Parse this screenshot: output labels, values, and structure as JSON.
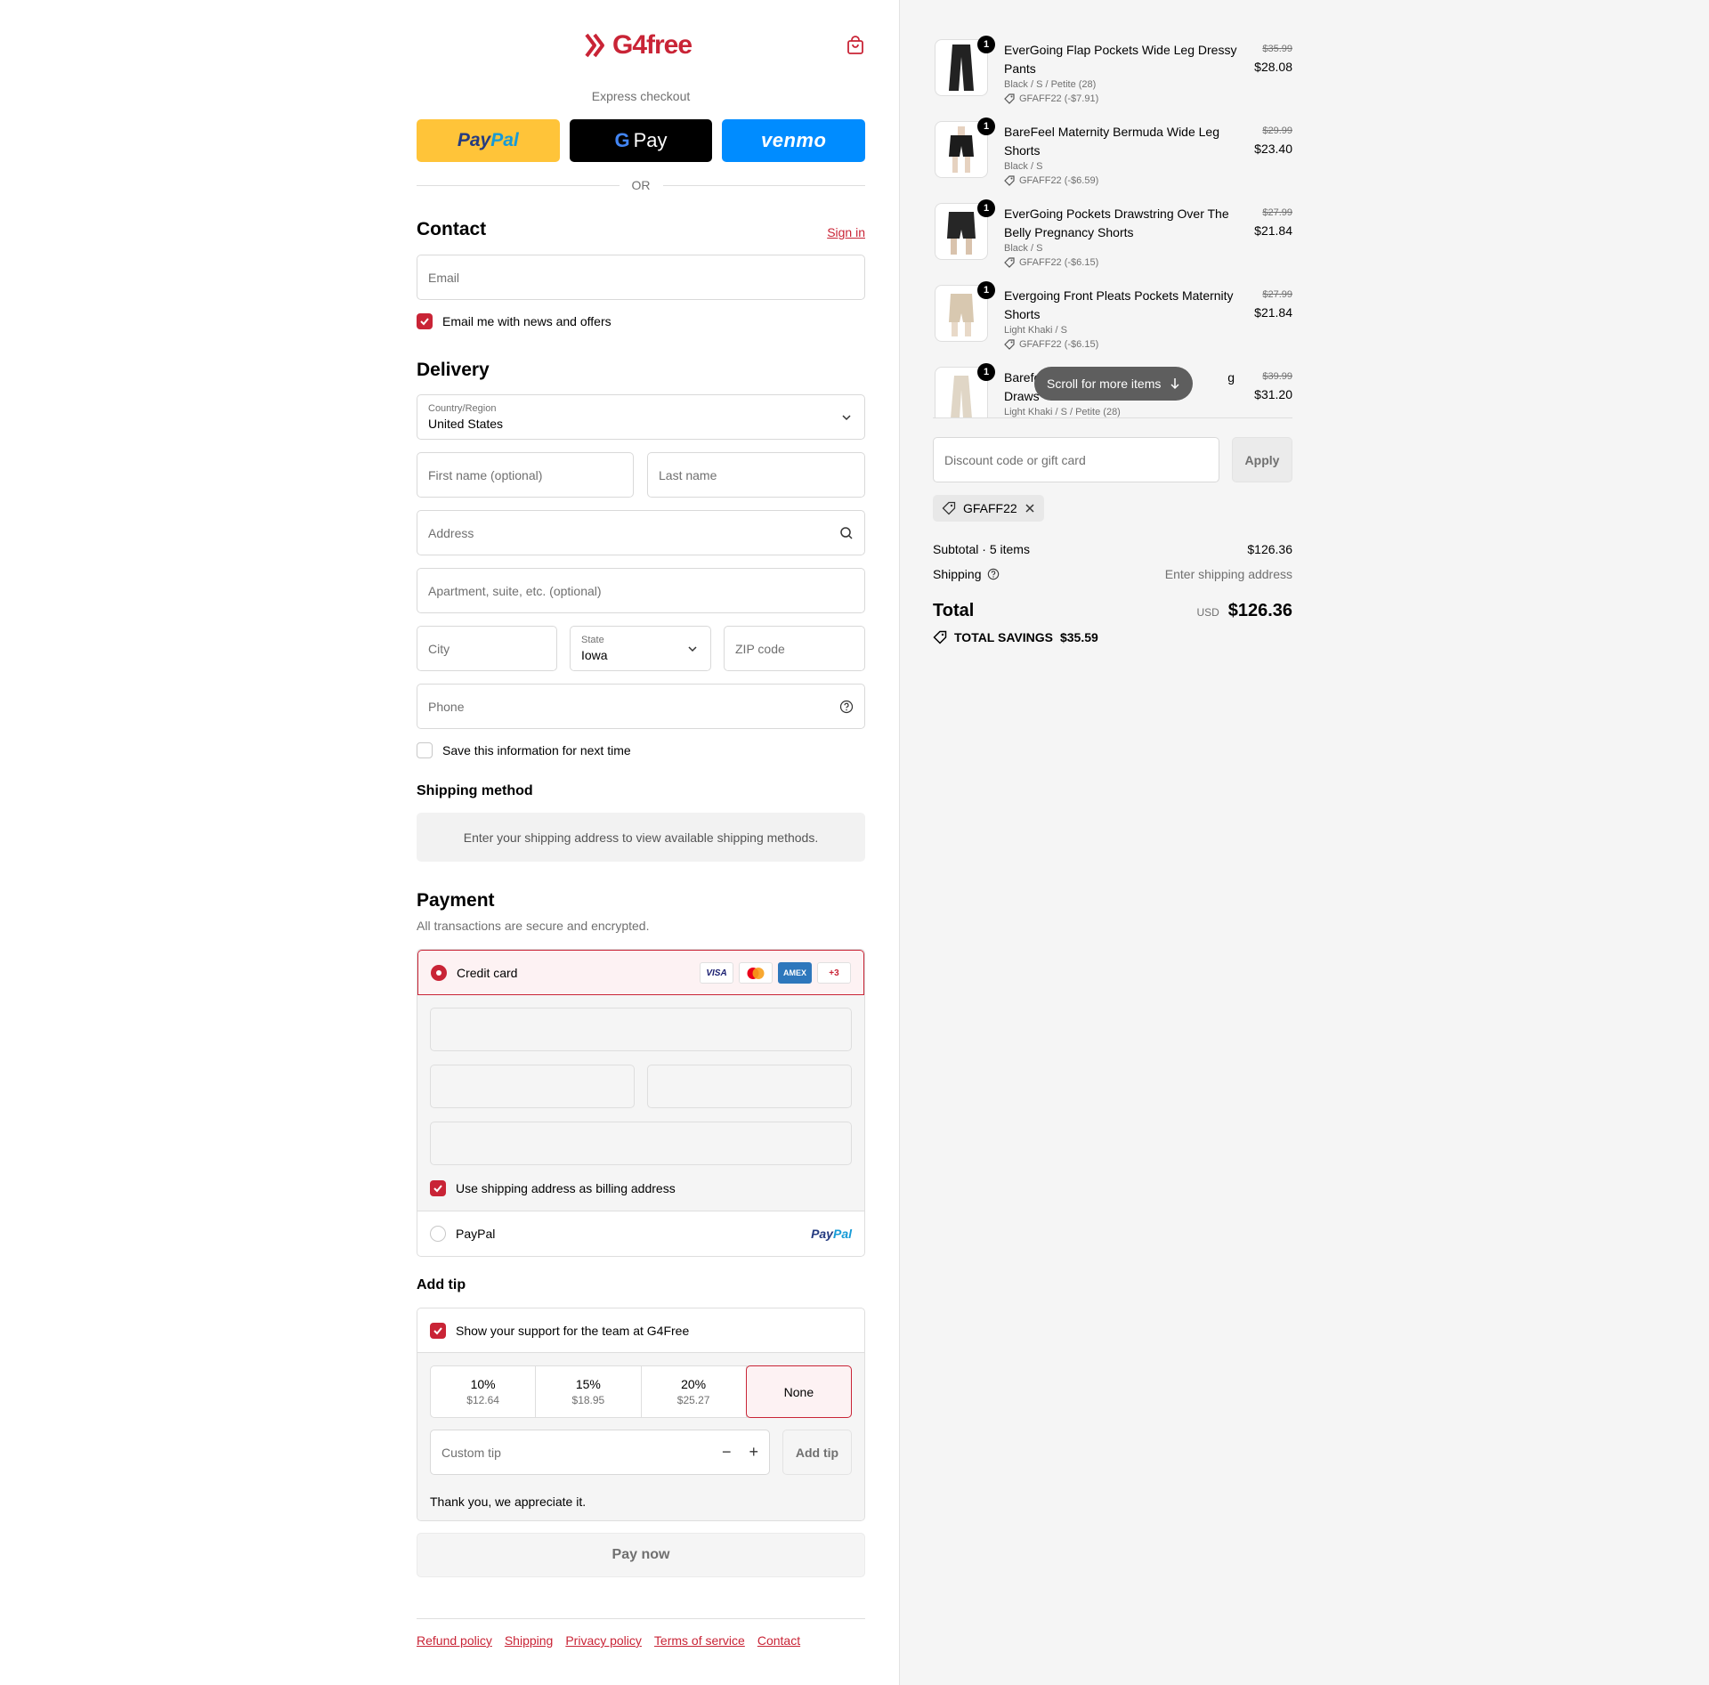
{
  "brand": {
    "name": "G4free",
    "accent": "#c92436"
  },
  "header": {
    "cart_icon": "shopping-bag-icon"
  },
  "express": {
    "label": "Express checkout",
    "paypal_a": "Pay",
    "paypal_b": "Pal",
    "gpay_g": "G",
    "gpay_label": "Pay",
    "venmo_label": "venmo",
    "or_label": "OR"
  },
  "contact": {
    "title": "Contact",
    "sign_in": "Sign in",
    "email_placeholder": "Email",
    "news_label": "Email me with news and offers",
    "news_checked": true
  },
  "delivery": {
    "title": "Delivery",
    "country_label": "Country/Region",
    "country_value": "United States",
    "first_name_placeholder": "First name (optional)",
    "last_name_placeholder": "Last name",
    "address_placeholder": "Address",
    "apartment_placeholder": "Apartment, suite, etc. (optional)",
    "city_placeholder": "City",
    "state_label": "State",
    "state_value": "Iowa",
    "zip_placeholder": "ZIP code",
    "phone_placeholder": "Phone",
    "save_label": "Save this information for next time",
    "save_checked": false
  },
  "shipping_method": {
    "title": "Shipping method",
    "message": "Enter your shipping address to view available shipping methods."
  },
  "payment": {
    "title": "Payment",
    "subtitle": "All transactions are secure and encrypted.",
    "credit_card_label": "Credit card",
    "card_logos": [
      "VISA",
      "mastercard",
      "AMEX",
      "+3"
    ],
    "billing_label": "Use shipping address as billing address",
    "billing_checked": true,
    "paypal_label": "PayPal",
    "paypal_logo_a": "Pay",
    "paypal_logo_b": "Pal"
  },
  "tip": {
    "title": "Add tip",
    "support_label": "Show your support for the team at G4Free",
    "support_checked": true,
    "options": [
      {
        "pct": "10%",
        "amount": "$12.64"
      },
      {
        "pct": "15%",
        "amount": "$18.95"
      },
      {
        "pct": "20%",
        "amount": "$25.27"
      },
      {
        "pct": "None",
        "amount": ""
      }
    ],
    "selected": "None",
    "custom_placeholder": "Custom tip",
    "minus": "−",
    "plus": "+",
    "add_button": "Add tip",
    "thanks": "Thank you, we appreciate it."
  },
  "pay_now": "Pay now",
  "footer": {
    "links": [
      "Refund policy",
      "Shipping",
      "Privacy policy",
      "Terms of service",
      "Contact"
    ]
  },
  "order": {
    "items": [
      {
        "name": "EverGoing Flap Pockets Wide Leg Dressy Pants",
        "variant": "Black / S / Petite (28)",
        "discount": "GFAFF22 (-$7.91)",
        "old_price": "$35.99",
        "price": "$28.08",
        "qty": "1",
        "color": "#222222"
      },
      {
        "name": "BareFeel Maternity Bermuda Wide Leg Shorts",
        "variant": "Black / S",
        "discount": "GFAFF22 (-$6.59)",
        "old_price": "$29.99",
        "price": "$23.40",
        "qty": "1",
        "color": "#1c1c1c"
      },
      {
        "name": "EverGoing Pockets Drawstring Over The Belly Pregnancy Shorts",
        "variant": "Black / S",
        "discount": "GFAFF22 (-$6.15)",
        "old_price": "$27.99",
        "price": "$21.84",
        "qty": "1",
        "color": "#262626"
      },
      {
        "name": "Evergoing Front Pleats Pockets Maternity Shorts",
        "variant": "Light Khaki / S",
        "discount": "GFAFF22 (-$6.15)",
        "old_price": "$27.99",
        "price": "$21.84",
        "qty": "1",
        "color": "#d8c8b0"
      },
      {
        "name_start": "Barefe",
        "name_end": "g",
        "name_line2": "Draws",
        "variant": "Light Khaki / S / Petite (28)",
        "old_price": "$39.99",
        "price": "$31.20",
        "qty": "1",
        "color": "#e0d6c6"
      }
    ],
    "scroll_label": "Scroll for more items",
    "discount_placeholder": "Discount code or gift card",
    "apply_label": "Apply",
    "applied_code": "GFAFF22",
    "subtotal_label": "Subtotal · 5 items",
    "subtotal_value": "$126.36",
    "shipping_label": "Shipping",
    "shipping_value": "Enter shipping address",
    "total_label": "Total",
    "currency": "USD",
    "total_value": "$126.36",
    "savings_label": "TOTAL SAVINGS",
    "savings_value": "$35.59"
  }
}
